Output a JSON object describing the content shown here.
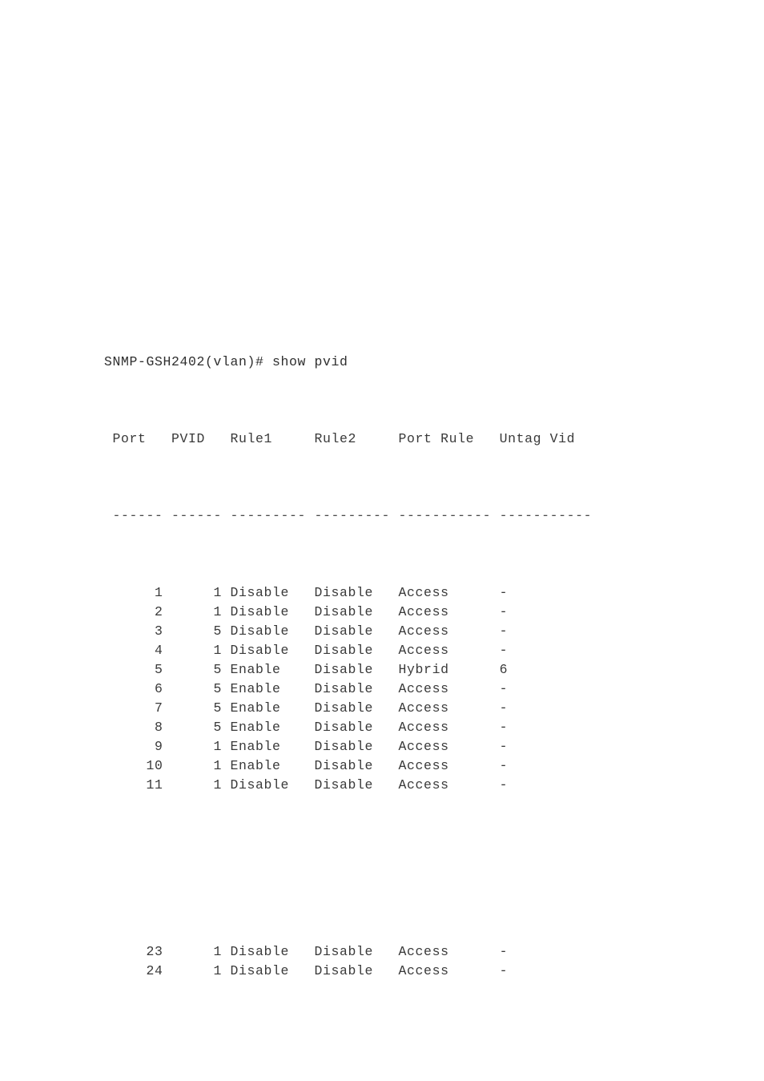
{
  "terminal": {
    "prompt": "SNMP-GSH2402(vlan)#",
    "command": "show pvid",
    "prompt_line": "SNMP-GSH2402(vlan)# show pvid",
    "device_name": "SNMP-GSH2402",
    "mode": "vlan",
    "text_color": "#3a3a3a",
    "background_color": "#ffffff"
  },
  "table": {
    "columns": [
      {
        "key": "port",
        "label": "Port",
        "width": 6,
        "align": "right"
      },
      {
        "key": "pvid",
        "label": "PVID",
        "width": 6,
        "align": "right"
      },
      {
        "key": "rule1",
        "label": "Rule1",
        "width": 9,
        "align": "left"
      },
      {
        "key": "rule2",
        "label": "Rule2",
        "width": 9,
        "align": "left"
      },
      {
        "key": "port_rule",
        "label": "Port Rule",
        "width": 11,
        "align": "left"
      },
      {
        "key": "untag_vid",
        "label": "Untag Vid",
        "width": 11,
        "align": "left"
      }
    ],
    "header_line": " Port   PVID   Rule1     Rule2     Port Rule   Untag Vid",
    "separator_line": " ------ ------ --------- --------- ----------- -----------",
    "separator_char": "-",
    "rows": [
      {
        "port": "1",
        "pvid": "1",
        "rule1": "Disable",
        "rule2": "Disable",
        "port_rule": "Access",
        "untag_vid": "-"
      },
      {
        "port": "2",
        "pvid": "1",
        "rule1": "Disable",
        "rule2": "Disable",
        "port_rule": "Access",
        "untag_vid": "-"
      },
      {
        "port": "3",
        "pvid": "5",
        "rule1": "Disable",
        "rule2": "Disable",
        "port_rule": "Access",
        "untag_vid": "-"
      },
      {
        "port": "4",
        "pvid": "1",
        "rule1": "Disable",
        "rule2": "Disable",
        "port_rule": "Access",
        "untag_vid": "-"
      },
      {
        "port": "5",
        "pvid": "5",
        "rule1": "Enable",
        "rule2": "Disable",
        "port_rule": "Hybrid",
        "untag_vid": "6"
      },
      {
        "port": "6",
        "pvid": "5",
        "rule1": "Enable",
        "rule2": "Disable",
        "port_rule": "Access",
        "untag_vid": "-"
      },
      {
        "port": "7",
        "pvid": "5",
        "rule1": "Enable",
        "rule2": "Disable",
        "port_rule": "Access",
        "untag_vid": "-"
      },
      {
        "port": "8",
        "pvid": "5",
        "rule1": "Enable",
        "rule2": "Disable",
        "port_rule": "Access",
        "untag_vid": "-"
      },
      {
        "port": "9",
        "pvid": "1",
        "rule1": "Enable",
        "rule2": "Disable",
        "port_rule": "Access",
        "untag_vid": "-"
      },
      {
        "port": "10",
        "pvid": "1",
        "rule1": "Enable",
        "rule2": "Disable",
        "port_rule": "Access",
        "untag_vid": "-"
      },
      {
        "port": "11",
        "pvid": "1",
        "rule1": "Disable",
        "rule2": "Disable",
        "port_rule": "Access",
        "untag_vid": "-"
      }
    ],
    "rows_after_gap": [
      {
        "port": "23",
        "pvid": "1",
        "rule1": "Disable",
        "rule2": "Disable",
        "port_rule": "Access",
        "untag_vid": "-"
      },
      {
        "port": "24",
        "pvid": "1",
        "rule1": "Disable",
        "rule2": "Disable",
        "port_rule": "Access",
        "untag_vid": "-"
      }
    ]
  }
}
